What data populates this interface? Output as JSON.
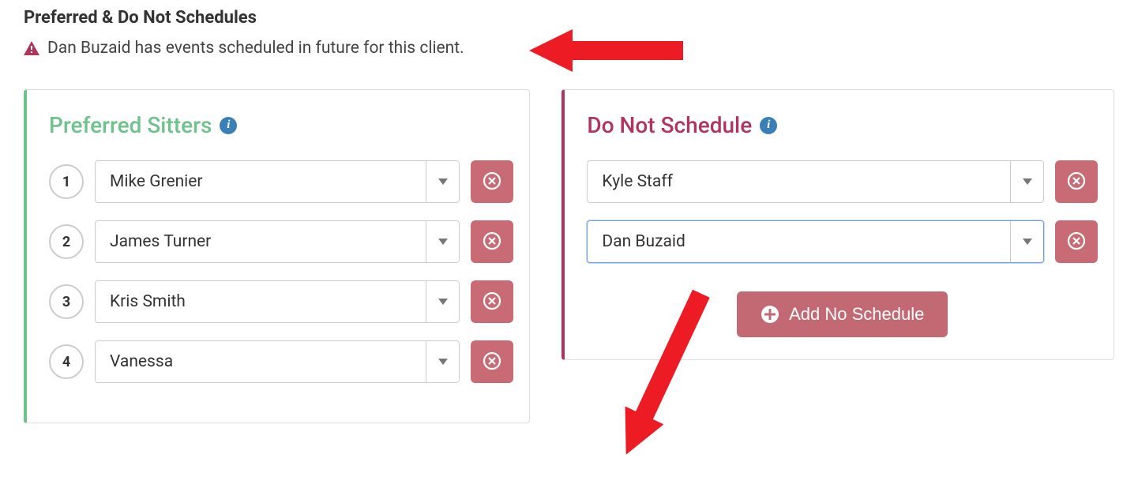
{
  "page_title": "Preferred & Do Not Schedules",
  "warning": {
    "text": "Dan Buzaid has events scheduled in future for this client."
  },
  "preferred": {
    "title": "Preferred Sitters",
    "items": [
      {
        "rank": "1",
        "name": "Mike Grenier"
      },
      {
        "rank": "2",
        "name": "James Turner"
      },
      {
        "rank": "3",
        "name": "Kris Smith"
      },
      {
        "rank": "4",
        "name": "Vanessa"
      }
    ]
  },
  "do_not": {
    "title": "Do Not Schedule",
    "items": [
      {
        "name": "Kyle Staff",
        "highlighted": false
      },
      {
        "name": "Dan Buzaid",
        "highlighted": true
      }
    ],
    "add_button_label": "Add No Schedule"
  },
  "annotation_arrow_color": "#ed1c24"
}
